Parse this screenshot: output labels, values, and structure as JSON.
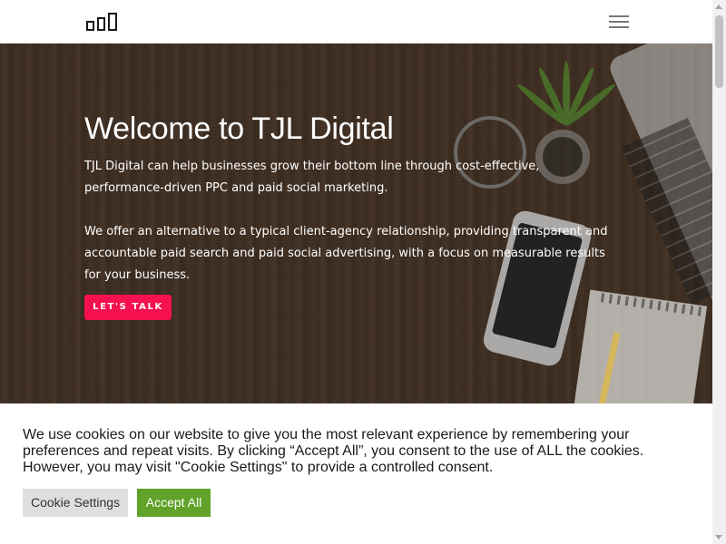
{
  "header": {
    "logo_icon": "bar-chart-logo-icon",
    "menu_icon": "hamburger-menu-icon"
  },
  "hero": {
    "title": "Welcome to TJL Digital",
    "paragraph_1": "TJL Digital can help businesses grow their bottom line through cost-effective, performance-driven PPC and paid social marketing.",
    "paragraph_2": "We offer an alternative to a typical client-agency relationship, providing transparent and accountable paid search and paid social advertising, with a focus on measurable results for your business.",
    "cta_label": "LET'S TALK",
    "cta_color": "#f5104f"
  },
  "cookie_banner": {
    "message": "We use cookies on our website to give you the most relevant experience by remembering your preferences and repeat visits. By clicking “Accept All”, you consent to the use of ALL the cookies. However, you may visit \"Cookie Settings\" to provide a controlled consent.",
    "settings_label": "Cookie Settings",
    "accept_label": "Accept All",
    "accept_color": "#61a229"
  }
}
